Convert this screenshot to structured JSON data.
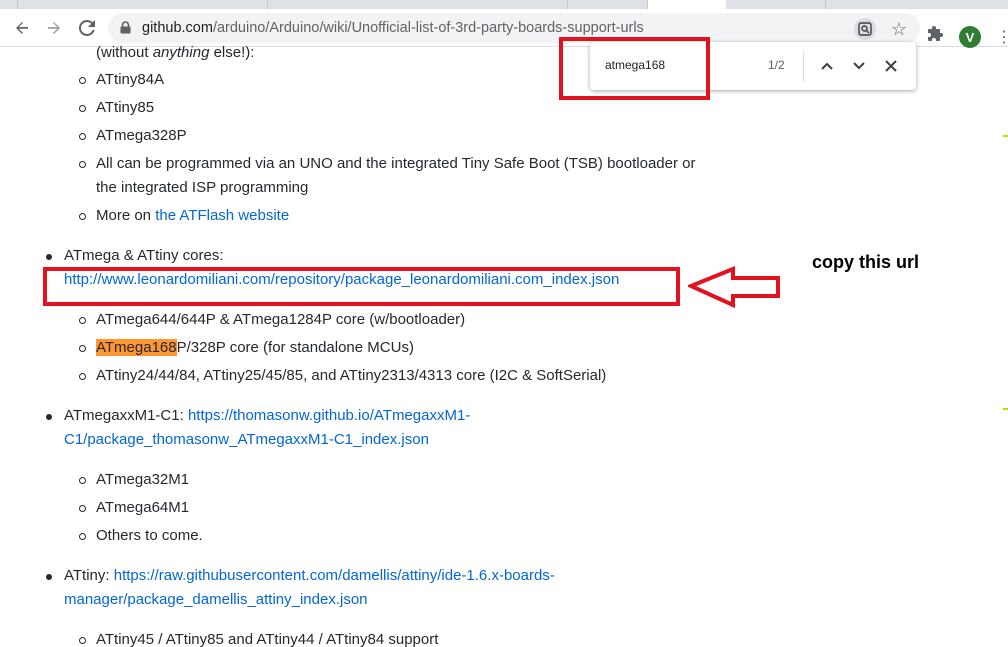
{
  "browser": {
    "url_host": "github.com",
    "url_path": "/arduino/Arduino/wiki/Unofficial-list-of-3rd-party-boards-support-urls",
    "profile_initial": "V",
    "profile_color": "#2e7d32"
  },
  "findbar": {
    "query": "atmega168",
    "count": "1/2"
  },
  "content": {
    "top_fragment": {
      "prefix": "(without ",
      "emphasis": "anything",
      "suffix": " else!):"
    },
    "atflash_items": [
      "ATtiny84A",
      "ATtiny85",
      "ATmega328P"
    ],
    "atflash_programming_line1": "All can be programmed via an UNO and the integrated Tiny Safe Boot (TSB) bootloader or",
    "atflash_programming_line2": "the integrated ISP programming",
    "more_on_prefix": "More on ",
    "more_on_link": "the ATFlash website",
    "atmega_attiny": {
      "title": "ATmega & ATtiny cores:",
      "url": "http://www.leonardomiliani.com/repository/package_leonardomiliani.com_index.json",
      "items": {
        "item1": "ATmega644/644P & ATmega1284P core (w/bootloader)",
        "item2_highlight": "ATmega168",
        "item2_rest": "P/328P core (for standalone MCUs)",
        "item3": "ATtiny24/44/84, ATtiny25/45/85, and ATtiny2313/4313 core (I2C & SoftSerial)"
      }
    },
    "atmegaxxm1": {
      "title": "ATmegaxxM1-C1",
      "colon": ":",
      "url_line1": "https://thomasonw.github.io/ATmegaxxM1-",
      "url_line2": "C1/package_thomasonw_ATmegaxxM1-C1_index.json",
      "items": [
        "ATmega32M1",
        "ATmega64M1",
        "Others to come."
      ]
    },
    "attiny": {
      "title": "ATtiny",
      "colon": ":",
      "url_line1": "https://raw.githubusercontent.com/damellis/attiny/ide-1.6.x-boards-",
      "url_line2": "manager/package_damellis_attiny_index.json",
      "items": [
        "ATtiny45 / ATtiny85 and ATtiny44 / ATtiny84 support"
      ]
    }
  },
  "annotation": {
    "note": "copy this url",
    "color": "#e2131f"
  }
}
